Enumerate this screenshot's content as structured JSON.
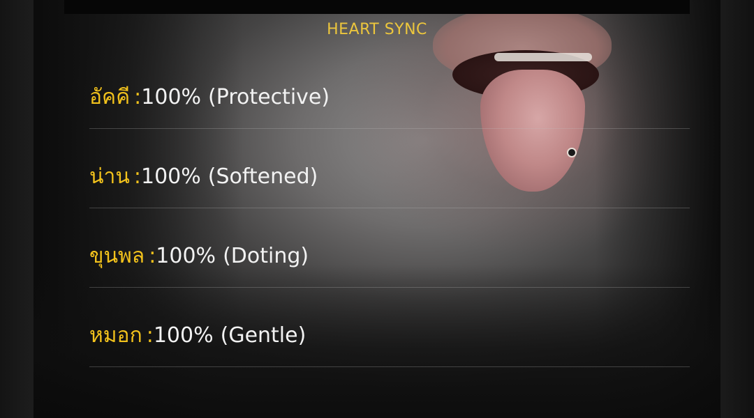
{
  "title": "HEART SYNC",
  "stats": [
    {
      "name": "อัคคี",
      "separator": ":",
      "value": "100%",
      "mood": "(Protective)"
    },
    {
      "name": "น่าน",
      "separator": ":",
      "value": "100%",
      "mood": "(Softened)"
    },
    {
      "name": "ขุนพล",
      "separator": ":",
      "value": "100%",
      "mood": "(Doting)"
    },
    {
      "name": "หมอก",
      "separator": ":",
      "value": "100%",
      "mood": "(Gentle)"
    }
  ],
  "colors": {
    "title": "#ecc63d",
    "name": "#f2c21c",
    "value": "#f2f2f2",
    "divider": "#bebebe"
  }
}
